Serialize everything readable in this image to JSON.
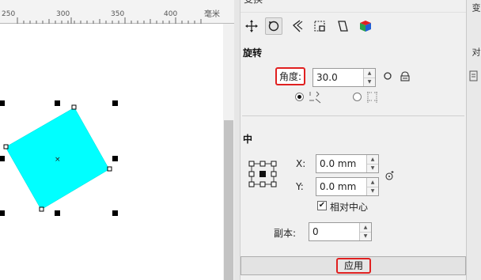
{
  "ruler": {
    "labels": [
      "250",
      "300",
      "350",
      "400"
    ],
    "unit": "毫米"
  },
  "docker": {
    "title": "变换",
    "side_tabs": [
      "变",
      "对"
    ],
    "tools": [
      "position-tool",
      "rotate-tool",
      "scale-mirror-tool",
      "size-tool",
      "skew-tool",
      "3d-color-tool"
    ],
    "rotate": {
      "section_title": "旋转",
      "angle_label": "角度:",
      "angle_value": "30.0"
    },
    "center": {
      "section_title": "中",
      "x_label": "X:",
      "x_value": "0.0 mm",
      "y_label": "Y:",
      "y_value": "0.0 mm",
      "relative_center_label": "相对中心",
      "relative_center_checked": true
    },
    "copies": {
      "label": "副本:",
      "value": "0"
    },
    "apply_label": "应用"
  },
  "colors": {
    "shape_fill": "#00ffff",
    "highlight": "#e02020"
  }
}
